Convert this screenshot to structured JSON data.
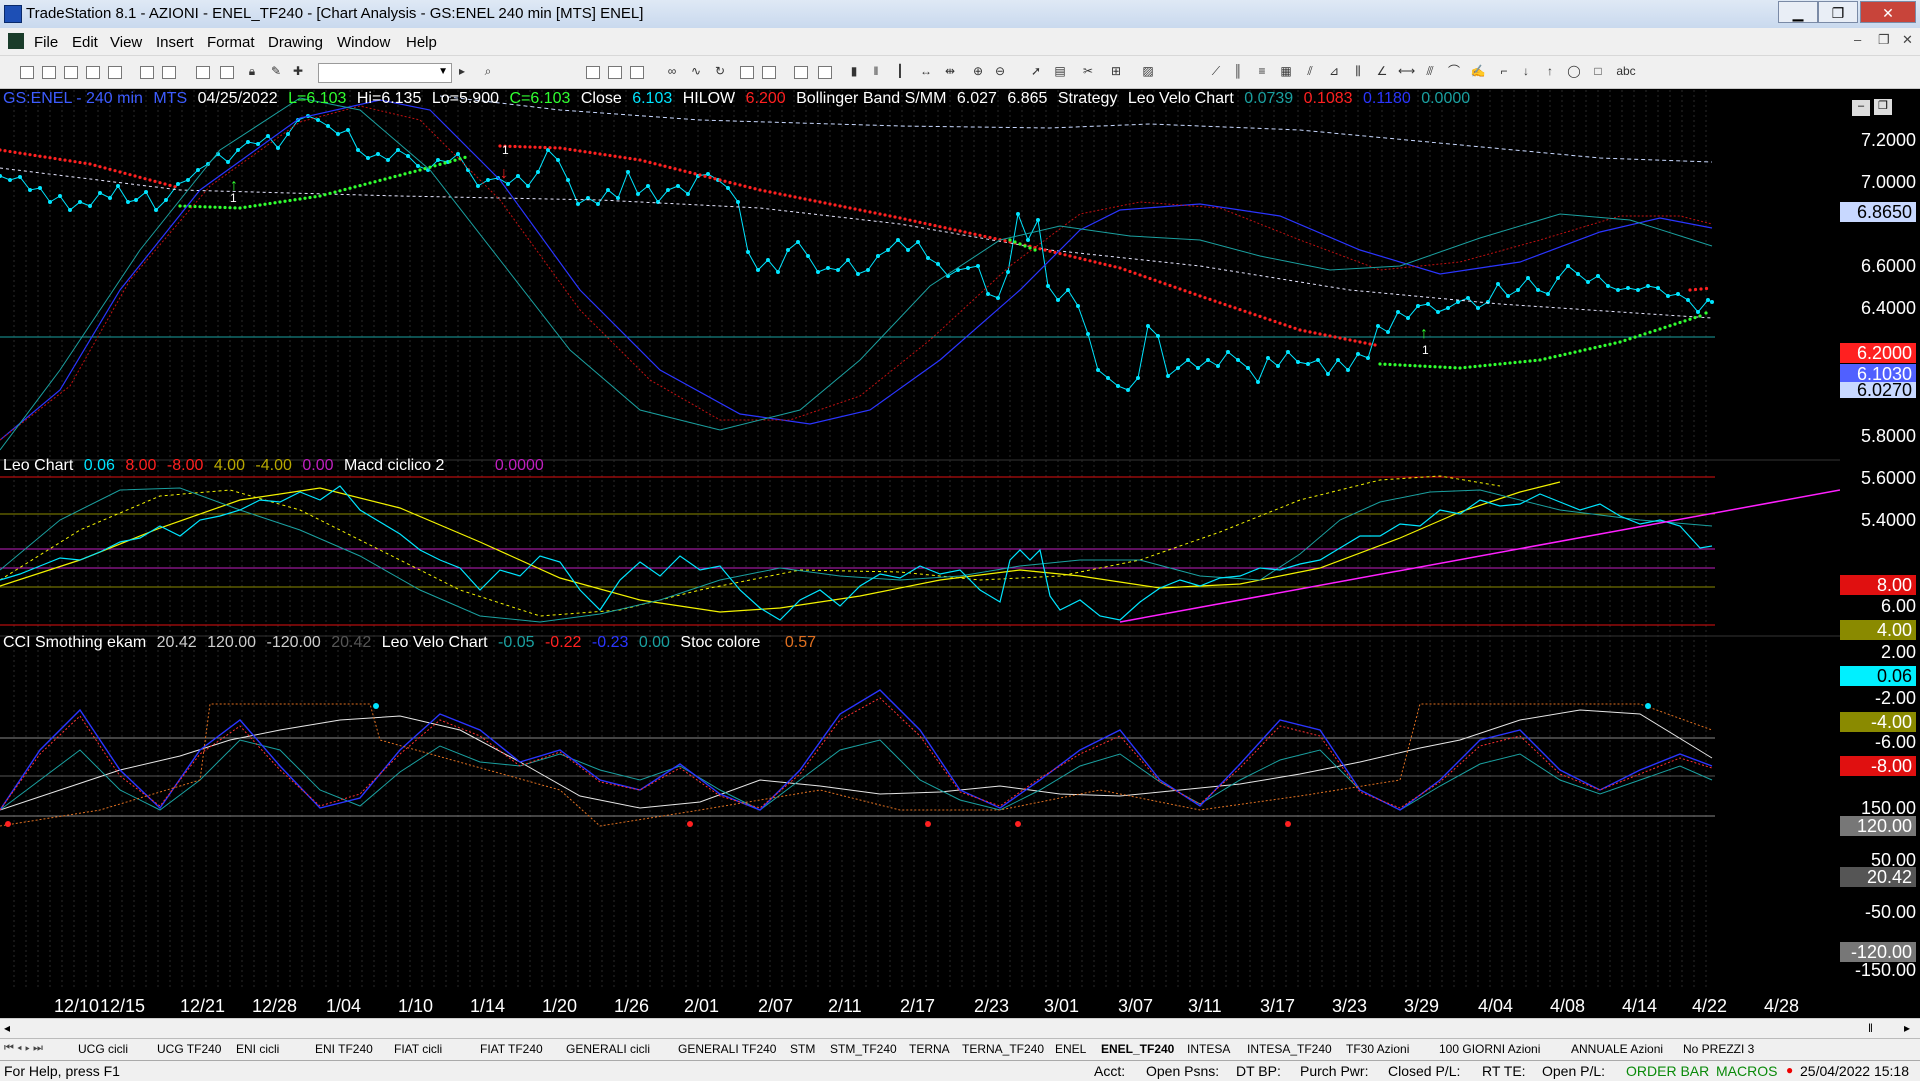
{
  "window": {
    "title": "TradeStation 8.1 - AZIONI - ENEL_TF240 - [Chart Analysis - GS:ENEL  240 min  [MTS] ENEL]",
    "min": "▁",
    "max": "❐",
    "close": "✕"
  },
  "menu": [
    "File",
    "Edit",
    "View",
    "Insert",
    "Format",
    "Drawing",
    "Window",
    "Help"
  ],
  "mdi_buttons": [
    "–",
    "❐",
    "✕"
  ],
  "toolbar": {
    "combo_value": ""
  },
  "header": {
    "symbol": "GS:ENEL - 240 min",
    "mts": "MTS",
    "date": "04/25/2022",
    "last": "L=6.103",
    "hi": "Hi=6.135",
    "lo": "Lo=5.900",
    "close_c": "C=6.103",
    "close_label": "Close",
    "close_val": "6.103",
    "hilow_label": "HILOW",
    "hilow_val": "6.200",
    "bb_label": "Bollinger Band S/MM",
    "bb_v1": "6.027",
    "bb_v2": "6.865",
    "strategy": "Strategy",
    "leo_label": "Leo Velo Chart",
    "leo_v1": "0.0739",
    "leo_v2": "0.1083",
    "leo_v3": "0.1180",
    "leo_v4": "0.0000"
  },
  "header2": {
    "label": "Leo Chart",
    "v1": "0.06",
    "v2": "8.00",
    "v3": "-8.00",
    "v4": "4.00",
    "v5": "-4.00",
    "v6": "0.00",
    "macd_label": "Macd ciclico 2",
    "macd_val": "0.0000"
  },
  "header3": {
    "label": "CCI Smothing ekam",
    "v1": "20.42",
    "v2": "120.00",
    "v3": "-120.00",
    "v4": "20.42",
    "leo_label": "Leo Velo Chart",
    "l1": "-0.05",
    "l2": "-0.22",
    "l3": "-0.23",
    "l4": "0.00",
    "stoc_label": "Stoc colore",
    "stoc_val": "0.57"
  },
  "price_axis": {
    "labels": [
      "7.2000",
      "7.0000",
      "6.6000",
      "6.4000",
      "5.8000",
      "5.6000",
      "5.4000"
    ],
    "box_upper": "6.8650",
    "box_hilow": "6.2000",
    "box_close": "6.1030",
    "box_lower": "6.0270"
  },
  "osc_axis": {
    "labels": [
      "6.00",
      "2.00",
      "-2.00",
      "-6.00"
    ],
    "box_8": "8.00",
    "box_4": "4.00",
    "box_val": "0.06",
    "box_m4": "-4.00",
    "box_m8": "-8.00"
  },
  "cci_axis": {
    "labels": [
      "150.00",
      "50.00",
      "-50.00",
      "-150.00"
    ],
    "box_120": "120.00",
    "box_val": "20.42",
    "box_m120": "-120.00"
  },
  "date_axis": [
    "12/10",
    "12/15",
    "12/21",
    "12/28",
    "1/04",
    "1/10",
    "1/14",
    "1/20",
    "1/26",
    "2/01",
    "2/07",
    "2/11",
    "2/17",
    "2/23",
    "3/01",
    "3/07",
    "3/11",
    "3/17",
    "3/23",
    "3/29",
    "4/04",
    "4/08",
    "4/14",
    "4/22",
    "4/28"
  ],
  "signals": {
    "sell_1": "1",
    "buy_1": "1",
    "buy_2": "1"
  },
  "tabs": [
    "UCG cicli",
    "UCG TF240",
    "ENI cicli",
    "ENI TF240",
    "FIAT cicli",
    "FIAT TF240",
    "GENERALI cicli",
    "GENERALI TF240",
    "STM",
    "STM_TF240",
    "TERNA",
    "TERNA_TF240",
    "ENEL",
    "ENEL_TF240",
    "INTESA",
    "INTESA_TF240",
    "TF30 Azioni",
    "100 GIORNI Azioni",
    "ANNUALE Azioni",
    "No PREZZI 3"
  ],
  "status": {
    "help": "For Help, press F1",
    "acct": "Acct:",
    "open_psns": "Open Psns:",
    "dt_bp": "DT BP:",
    "purch_pwr": "Purch Pwr:",
    "closed_pl": "Closed P/L:",
    "rt_te": "RT TE:",
    "open_pl": "Open P/L:",
    "order_bar": "ORDER BAR",
    "macros": "MACROS",
    "datetime": "25/04/2022 15:18"
  },
  "colors": {
    "price": "#00e5ff",
    "bb_upper": "#c8d8ff",
    "hilow_red": "#ff2020",
    "hilow_green": "#30ff30",
    "blue_osc": "#2a35ff",
    "teal": "#1aa0a0",
    "yellow": "#f2f200",
    "magenta": "#ff20ff"
  },
  "chart_data": {
    "type": "line",
    "series": [
      {
        "name": "Close",
        "values": [
          6.103
        ]
      },
      {
        "name": "HILOW",
        "values": [
          6.2
        ]
      },
      {
        "name": "Bollinger Band S/MM",
        "values": [
          6.027,
          6.865
        ]
      }
    ],
    "ylim": [
      5.3,
      7.3
    ]
  }
}
